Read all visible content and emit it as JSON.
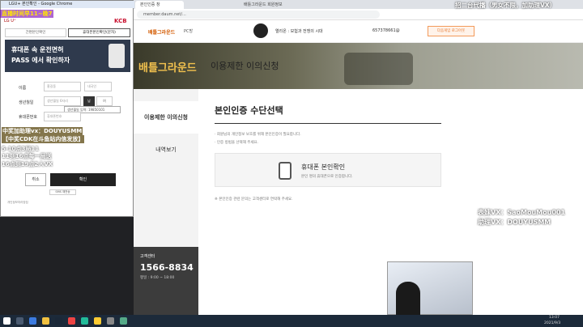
{
  "overlay": {
    "top_left": "直播时间早11~晚7",
    "top_right": "招二台代播（男女不限，加助理VX）",
    "right1": "表妹VX：SaoMouMou001",
    "right2": "助理VX：DOUYUSMM",
    "left1": "中奖加助理vx：DOUYUSMM",
    "left2": "【中奖CDK在斗鱼站内信发放】",
    "left3": "5-10点3局11",
    "left4": "11到16点每一局送",
    "left5": "16点到19点2人VX"
  },
  "browser": {
    "tabs": [
      {
        "label": "본인인증 창"
      },
      {
        "label": "배틀그라운드 회원정보"
      }
    ],
    "url": "member.daum.net/...",
    "site": {
      "logo": "배틀그라운드",
      "nav": "PC방",
      "user_name": "엘리온 : 모험과 전쟁의 시대",
      "user_id": "657378661@",
      "logout": "다음게임 로그아웃"
    },
    "banner": {
      "game": "배틀그라운드",
      "title": "이용제한 이의신청"
    },
    "left_nav": [
      {
        "label": "이용제한 이의신청"
      },
      {
        "label": "내역보기"
      }
    ],
    "cs": {
      "label": "고객센터",
      "phone": "1566-8834",
      "hours": "평일 : 9:00 ~ 18:00"
    },
    "content": {
      "heading": "본인인증 수단선택",
      "note1": "· 회원님의 개인정보 보호를 위해 본인인증이 필요합니다.",
      "note2": "· 인증 방법을 선택해 주세요.",
      "method_title": "휴대폰 본인확인",
      "method_desc": "본인 명의 휴대폰으로 인증합니다.",
      "footer_note": "※ 본인인증 관련 문의는 고객센터로 연락해 주세요."
    }
  },
  "popup": {
    "title": "LGU+ 본인확인 - Google Chrome",
    "brand": "KCB",
    "tab1": "간편본인확인",
    "tab2": "휴대폰본인확인(문자)",
    "promo1": "휴대폰 속 운전면허",
    "promo2": "PASS 에서 확인하자",
    "fields": [
      {
        "label": "이름",
        "value": "홍길동"
      },
      {
        "label": "생년월일",
        "value": "생년월일 6자리"
      },
      {
        "label": "휴대폰번호",
        "value": "휴대폰번호"
      }
    ],
    "gender": "내국인",
    "tooltip": "생년월일 입력: 19850101",
    "cancel": "취소",
    "confirm": "확인",
    "footer_link": "개인정보처리방침",
    "footer_link2": "SMS 재전송"
  },
  "taskbar": {
    "time": "13:07",
    "date": "2021/9/3"
  }
}
